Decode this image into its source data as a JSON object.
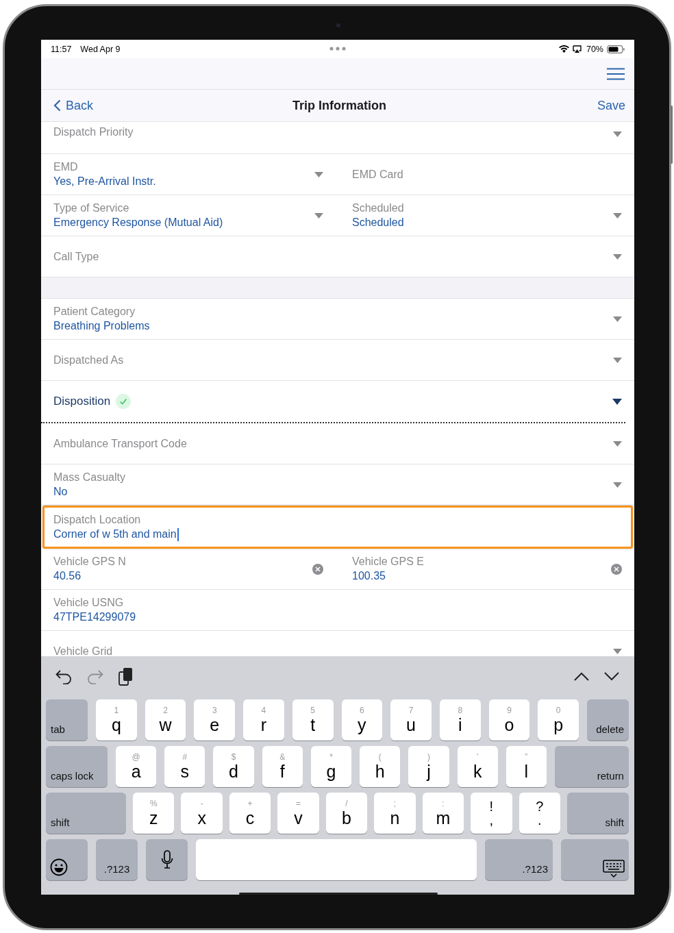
{
  "status_bar": {
    "time": "11:57",
    "date": "Wed Apr 9",
    "battery": "70%"
  },
  "nav": {
    "back": "Back",
    "title": "Trip Information",
    "action": "Save"
  },
  "rows": [
    {
      "kind": "fields",
      "fields": [
        {
          "label": "Dispatch Priority",
          "kind": "select"
        }
      ]
    },
    {
      "kind": "fields",
      "fields": [
        {
          "label": "EMD",
          "value": "Yes, Pre-Arrival Instr.",
          "kind": "select"
        },
        {
          "label": "EMD Card",
          "kind": "text"
        }
      ]
    },
    {
      "kind": "fields",
      "fields": [
        {
          "label": "Type of Service",
          "value": "Emergency Response (Mutual Aid)",
          "kind": "select"
        },
        {
          "label": "Scheduled",
          "value": "Scheduled",
          "kind": "select"
        }
      ]
    },
    {
      "kind": "fields",
      "fields": [
        {
          "label": "Call Type",
          "kind": "select"
        }
      ]
    },
    {
      "kind": "spacer"
    },
    {
      "kind": "fields",
      "fields": [
        {
          "label": "Patient Category",
          "value": "Breathing Problems",
          "kind": "select"
        }
      ]
    },
    {
      "kind": "fields",
      "fields": [
        {
          "label": "Dispatched As",
          "kind": "select"
        }
      ]
    },
    {
      "kind": "section",
      "label": "Disposition",
      "complete": true
    },
    {
      "kind": "fields",
      "fields": [
        {
          "label": "Ambulance Transport Code",
          "kind": "select"
        }
      ]
    },
    {
      "kind": "fields",
      "fields": [
        {
          "label": "Mass Casualty",
          "value": "No",
          "kind": "select"
        }
      ]
    },
    {
      "kind": "fields",
      "fields": [
        {
          "label": "Dispatch Location",
          "value": "Corner of w 5th and main",
          "kind": "text",
          "focused": true
        }
      ]
    },
    {
      "kind": "fields",
      "fields": [
        {
          "label": "Vehicle GPS N",
          "value": "40.56",
          "kind": "clearable"
        },
        {
          "label": "Vehicle GPS E",
          "value": "100.35",
          "kind": "clearable"
        }
      ]
    },
    {
      "kind": "fields",
      "fields": [
        {
          "label": "Vehicle USNG",
          "value": "47TPE14299079",
          "kind": "text"
        }
      ]
    },
    {
      "kind": "fields",
      "fields": [
        {
          "label": "Vehicle Grid",
          "kind": "select"
        }
      ]
    }
  ],
  "keyboard_toolbar": [
    {
      "kind": "undo",
      "disabled": false
    },
    {
      "kind": "redo",
      "disabled": true
    },
    {
      "kind": "paste",
      "disabled": false
    },
    {
      "kind": "previous",
      "disabled": false
    },
    {
      "kind": "next",
      "disabled": false
    }
  ],
  "keyboard": [
    [
      {
        "kind": "mod",
        "label": "tab"
      },
      {
        "kind": "letter",
        "label": "q",
        "hint": "1"
      },
      {
        "kind": "letter",
        "label": "w",
        "hint": "2"
      },
      {
        "kind": "letter",
        "label": "e",
        "hint": "3"
      },
      {
        "kind": "letter",
        "label": "r",
        "hint": "4"
      },
      {
        "kind": "letter",
        "label": "t",
        "hint": "5"
      },
      {
        "kind": "letter",
        "label": "y",
        "hint": "6"
      },
      {
        "kind": "letter",
        "label": "u",
        "hint": "7"
      },
      {
        "kind": "letter",
        "label": "i",
        "hint": "8"
      },
      {
        "kind": "letter",
        "label": "o",
        "hint": "9"
      },
      {
        "kind": "letter",
        "label": "p",
        "hint": "0"
      },
      {
        "kind": "mod",
        "label": "delete"
      }
    ],
    [
      {
        "kind": "mod",
        "label": "caps lock"
      },
      {
        "kind": "letter",
        "label": "a",
        "hint": "@"
      },
      {
        "kind": "letter",
        "label": "s",
        "hint": "#"
      },
      {
        "kind": "letter",
        "label": "d",
        "hint": "$"
      },
      {
        "kind": "letter",
        "label": "f",
        "hint": "&"
      },
      {
        "kind": "letter",
        "label": "g",
        "hint": "*"
      },
      {
        "kind": "letter",
        "label": "h",
        "hint": "("
      },
      {
        "kind": "letter",
        "label": "j",
        "hint": ")"
      },
      {
        "kind": "letter",
        "label": "k",
        "hint": "’"
      },
      {
        "kind": "letter",
        "label": "l",
        "hint": "”"
      },
      {
        "kind": "mod",
        "label": "return"
      }
    ],
    [
      {
        "kind": "mod",
        "label": "shift"
      },
      {
        "kind": "letter",
        "label": "z",
        "hint": "%"
      },
      {
        "kind": "letter",
        "label": "x",
        "hint": "-"
      },
      {
        "kind": "letter",
        "label": "c",
        "hint": "+"
      },
      {
        "kind": "letter",
        "label": "v",
        "hint": "="
      },
      {
        "kind": "letter",
        "label": "b",
        "hint": "/"
      },
      {
        "kind": "letter",
        "label": "n",
        "hint": ";"
      },
      {
        "kind": "letter",
        "label": "m",
        "hint": ":"
      },
      {
        "kind": "punct",
        "label": ",",
        "hint": "!"
      },
      {
        "kind": "punct",
        "label": ".",
        "hint": "?"
      },
      {
        "kind": "mod",
        "label": "shift"
      }
    ],
    [
      {
        "kind": "emoji"
      },
      {
        "kind": "mod",
        "label": ".?123"
      },
      {
        "kind": "dictation"
      },
      {
        "kind": "space"
      },
      {
        "kind": "mod",
        "label": ".?123"
      },
      {
        "kind": "dismiss"
      }
    ]
  ]
}
